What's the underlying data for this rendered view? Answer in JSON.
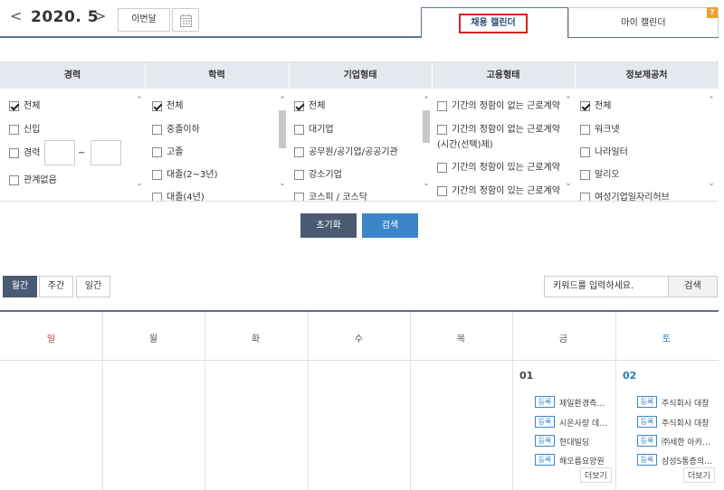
{
  "nav": {
    "prev": "<",
    "next": ">",
    "month": "2020. 5",
    "this_month": "이번달",
    "calendar_icon": "calendar-icon"
  },
  "tabs": {
    "hiring": "채용 캘린더",
    "my": "마이 캘린더",
    "help": "?"
  },
  "filters": {
    "headers": [
      "경력",
      "학력",
      "기업형태",
      "고용형태",
      "정보제공처"
    ],
    "career": {
      "all": "전체",
      "new": "신입",
      "experienced": "경력",
      "tilde": "~",
      "none": "관계없음"
    },
    "education": [
      "전체",
      "중졸이하",
      "고졸",
      "대졸(2~3년)",
      "대졸(4년)"
    ],
    "company": [
      "전체",
      "대기업",
      "공무원/공기업/공공기관",
      "강소기업",
      "코스피 / 코스닥"
    ],
    "employment": [
      "기간의 정함이 없는 근로계약",
      "기간의 정함이 없는 근로계약",
      "(시간(선택)제)",
      "기간의 정함이 있는 근로계약",
      "기간의 정함이 있는 근로계약"
    ],
    "provider": [
      "전체",
      "워크넷",
      "나라일터",
      "알리오",
      "여성기업일자리허브"
    ]
  },
  "actions": {
    "reset": "초기화",
    "search": "검색"
  },
  "view_tabs": [
    "월간",
    "주간",
    "일간"
  ],
  "keyword": {
    "placeholder": "키워드를 입력하세요.",
    "button": "검색"
  },
  "calendar": {
    "weekdays": [
      "일",
      "월",
      "화",
      "수",
      "목",
      "금",
      "토"
    ],
    "fri": {
      "day": "01",
      "events": [
        {
          "badge": "등록",
          "name": "제일환경측…"
        },
        {
          "badge": "등록",
          "name": "시온사랑 데…"
        },
        {
          "badge": "등록",
          "name": "현대빌딩"
        },
        {
          "badge": "등록",
          "name": "해오름요양원"
        }
      ],
      "more": "더보기"
    },
    "sat": {
      "day": "02",
      "events": [
        {
          "badge": "등록",
          "name": "주식회사 대창"
        },
        {
          "badge": "등록",
          "name": "주식회사 대창"
        },
        {
          "badge": "등록",
          "name": "㈜세한 아카…"
        },
        {
          "badge": "등록",
          "name": "삼성S통증의…"
        }
      ],
      "more": "더보기"
    }
  },
  "colors": {
    "accent": "#3a86c8",
    "dark": "#4b5a73",
    "sunday": "#c0392b",
    "saturday": "#2a7ab8"
  }
}
